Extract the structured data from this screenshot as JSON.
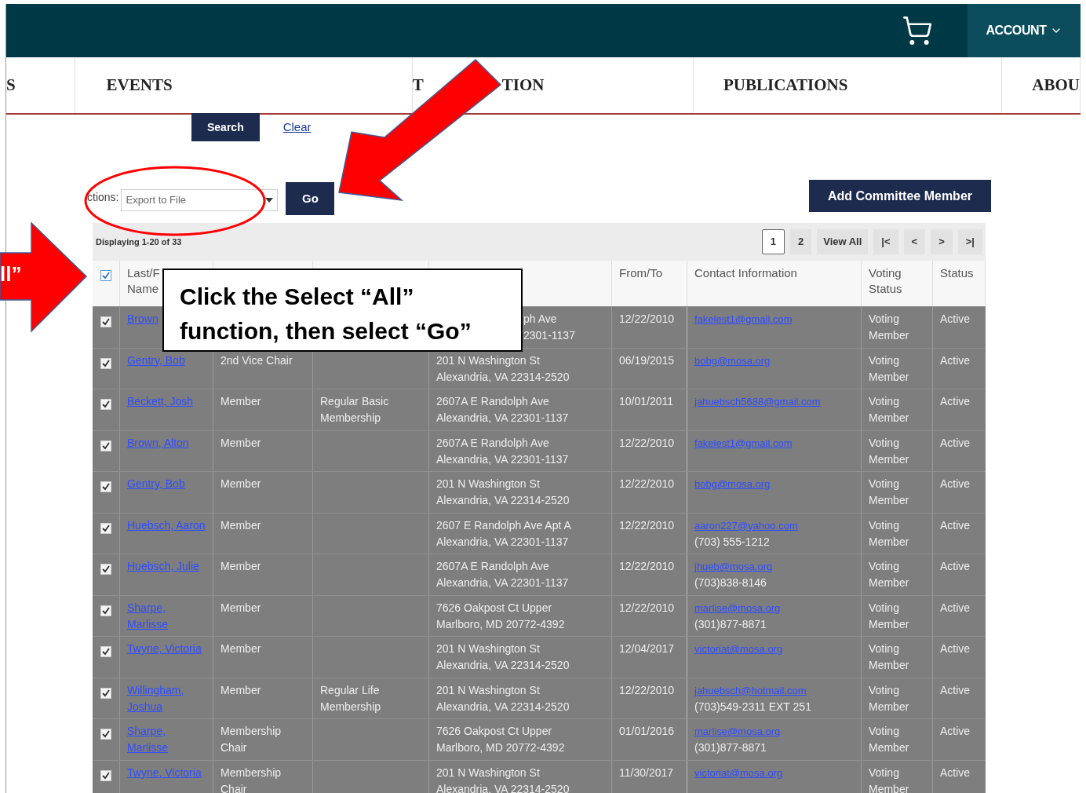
{
  "header": {
    "account": "ACCOUNT"
  },
  "nav": [
    {
      "parts": [
        "S"
      ]
    },
    {
      "parts": [
        "EVENTS"
      ]
    },
    {
      "parts": [
        "T",
        "TION"
      ]
    },
    {
      "parts": [
        "PUBLICATIONS"
      ]
    },
    {
      "parts": [
        "ABOU"
      ]
    }
  ],
  "search_buttons": {
    "search": "Search",
    "clear": "Clear"
  },
  "actions": {
    "label": "ctions:",
    "select_value": "Export to File",
    "go": "Go",
    "add": "Add Committee Member"
  },
  "displaying": "Displaying 1-20 of 33",
  "pagination": [
    {
      "label": "1",
      "selected": true
    },
    {
      "label": "2",
      "selected": false
    },
    {
      "label": "View All",
      "selected": false
    },
    {
      "label": "|<",
      "selected": false
    },
    {
      "label": "<",
      "selected": false
    },
    {
      "label": ">",
      "selected": false
    },
    {
      "label": ">|",
      "selected": false
    }
  ],
  "table": {
    "select_all_checked": true,
    "columns": [
      {
        "label": "Last/F Name"
      },
      {},
      {},
      {},
      {
        "label": "From/To"
      },
      {
        "label": "Contact Information"
      },
      {
        "label": "Voting Status"
      },
      {
        "label": "Status"
      }
    ],
    "rows": [
      {
        "checked": true,
        "address_cut": true,
        "name": "Brown",
        "address": [
          "ph Ave",
          "2301-1137"
        ],
        "from_to": "12/22/2010",
        "email": "fakelest1@gmail.com",
        "voting": "Voting Member",
        "status": "Active"
      },
      {
        "checked": true,
        "address_cut": false,
        "name": "Gentry, Bob",
        "position": "2nd Vice Chair",
        "address": [
          "201 N Washington St",
          "Alexandria, VA  22314-2520"
        ],
        "from_to": "06/19/2015",
        "email": "bobg@mosa.org",
        "voting": "Voting Member",
        "status": "Active"
      },
      {
        "checked": true,
        "address_cut": false,
        "name": "Beckett, Josh",
        "position": "Member",
        "membership": "Regular Basic Membership",
        "address": [
          "2607A E Randolph Ave",
          "Alexandria, VA  22301-1137"
        ],
        "from_to": "10/01/2011",
        "email": "jahuebsch5688@gmail.com",
        "voting": "Voting Member",
        "status": "Active"
      },
      {
        "checked": true,
        "address_cut": false,
        "name": "Brown, Alton",
        "position": "Member",
        "address": [
          "2607A E Randolph Ave",
          "Alexandria, VA  22301-1137"
        ],
        "from_to": "12/22/2010",
        "email": "fakelest1@gmail.com",
        "voting": "Voting Member",
        "status": "Active"
      },
      {
        "checked": true,
        "address_cut": false,
        "name": "Gentry, Bob",
        "position": "Member",
        "address": [
          "201 N Washington St",
          "Alexandria, VA  22314-2520"
        ],
        "from_to": "12/22/2010",
        "email": "bobg@mosa.org",
        "voting": "Voting Member",
        "status": "Active"
      },
      {
        "checked": true,
        "address_cut": false,
        "name": "Huebsch, Aaron",
        "position": "Member",
        "address": [
          "2607 E Randolph Ave Apt A",
          "Alexandria, VA  22301-1137"
        ],
        "from_to": "12/22/2010",
        "email": "aaron227@yahoo.com",
        "phone": "(703) 555-1212",
        "voting": "Voting Member",
        "status": "Active"
      },
      {
        "checked": true,
        "address_cut": false,
        "name": "Huebsch, Julie",
        "position": "Member",
        "address": [
          "2607A E Randolph Ave",
          "Alexandria, VA  22301-1137"
        ],
        "from_to": "12/22/2010",
        "email": "jhueb@mosa.org",
        "phone": "(703)838-8146",
        "voting": "Voting Member",
        "status": "Active"
      },
      {
        "checked": true,
        "address_cut": false,
        "name": "Sharpe, Marlisse",
        "position": "Member",
        "address": [
          "7626 Oakpost Ct Upper",
          "Marlboro, MD  20772-4392"
        ],
        "from_to": "12/22/2010",
        "email": "marlise@mosa.org",
        "phone": "(301)877-8871",
        "voting": "Voting Member",
        "status": "Active"
      },
      {
        "checked": true,
        "address_cut": false,
        "name": "Twyne, Victoria",
        "position": "Member",
        "address": [
          "201 N Washington St",
          "Alexandria, VA  22314-2520"
        ],
        "from_to": "12/04/2017",
        "email": "victoriat@mosa.org",
        "voting": "Voting Member",
        "status": "Active"
      },
      {
        "checked": true,
        "address_cut": false,
        "name": "Willingham, Joshua",
        "position": "Member",
        "membership": "Regular Life Membership",
        "address": [
          "201 N Washington St",
          "Alexandria, VA  22314-2520"
        ],
        "from_to": "12/22/2010",
        "email": "jahuebsch@hotmail.com",
        "phone": "(703)549-2311  EXT 251",
        "voting": "Voting Member",
        "status": "Active"
      },
      {
        "checked": true,
        "address_cut": false,
        "name": "Sharpe, Marlisse",
        "position": "Membership Chair",
        "address": [
          "7626 Oakpost Ct Upper",
          "Marlboro, MD  20772-4392"
        ],
        "from_to": "01/01/2016",
        "email": "marlise@mosa.org",
        "phone": "(301)877-8871",
        "voting": "Voting Member",
        "status": "Active"
      },
      {
        "checked": true,
        "address_cut": false,
        "name": "Twyne, Victoria",
        "position": "Membership Chair",
        "address": [
          "201 N Washington St",
          "Alexandria, VA  22314-2520"
        ],
        "from_to": "11/30/2017",
        "email": "victoriat@mosa.org",
        "voting": "Voting Member",
        "status": "Active"
      }
    ]
  },
  "annotations": {
    "left_arrow_text": "ll”",
    "callout": "Click the Select “All” function, then select “Go”"
  }
}
